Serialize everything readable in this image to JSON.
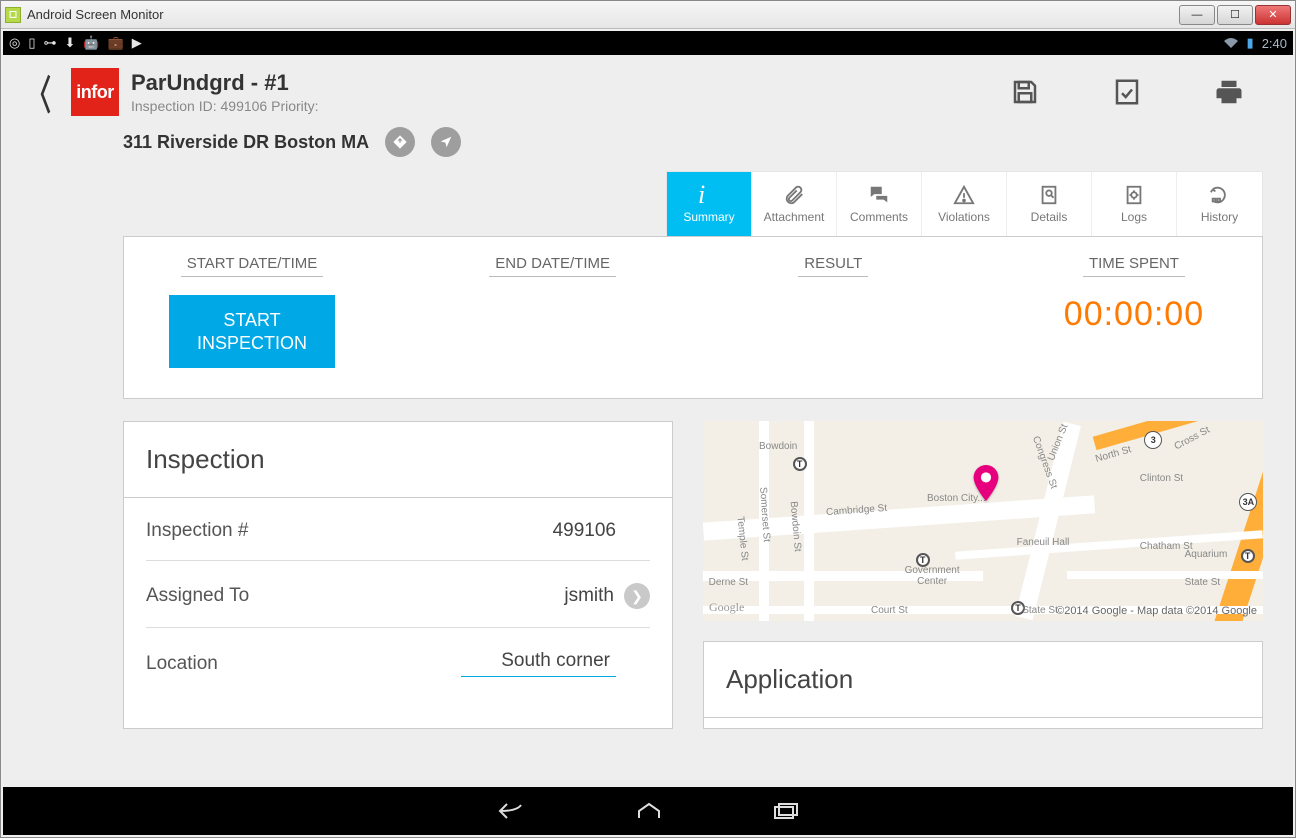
{
  "window": {
    "title": "Android Screen Monitor"
  },
  "statusbar": {
    "time": "2:40"
  },
  "header": {
    "title": "ParUndgrd - #1",
    "id_label": "Inspection ID:",
    "id_value": "499106",
    "priority_label": "Priority:",
    "priority_value": ""
  },
  "address": {
    "text": "311 Riverside DR Boston MA"
  },
  "tabs": {
    "summary": "Summary",
    "attachment": "Attachment",
    "comments": "Comments",
    "violations": "Violations",
    "details": "Details",
    "logs": "Logs",
    "history": "History"
  },
  "timer": {
    "start_label": "START DATE/TIME",
    "end_label": "END DATE/TIME",
    "result_label": "RESULT",
    "spent_label": "TIME SPENT",
    "start_button": "START\nINSPECTION",
    "value": "00:00:00"
  },
  "inspection": {
    "title": "Inspection",
    "number_label": "Inspection #",
    "number_value": "499106",
    "assigned_label": "Assigned To",
    "assigned_value": "jsmith",
    "location_label": "Location",
    "location_value": "South corner"
  },
  "map": {
    "attribution": "©2014 Google - Map data ©2014 Google",
    "logo": "Google",
    "labels": {
      "bowdoin": "Bowdoin",
      "cambridge": "Cambridge St",
      "somerset": "Somerset St",
      "bowdoin_st": "Bowdoin St",
      "temple": "Temple St",
      "derne": "Derne St",
      "bostoncity": "Boston City...",
      "govcenter": "Government\nCenter",
      "court": "Court St",
      "state": "State St",
      "state2": "State St",
      "congress": "Congress St",
      "union": "Union St",
      "north": "North St",
      "clinton": "Clinton St",
      "chatham": "Chatham St",
      "faneuil": "Faneuil Hall",
      "aquarium": "Aquarium",
      "cross": "Cross St",
      "route3": "3",
      "route3a": "3A"
    }
  },
  "application": {
    "title": "Application"
  },
  "logo": {
    "text": "infor"
  }
}
